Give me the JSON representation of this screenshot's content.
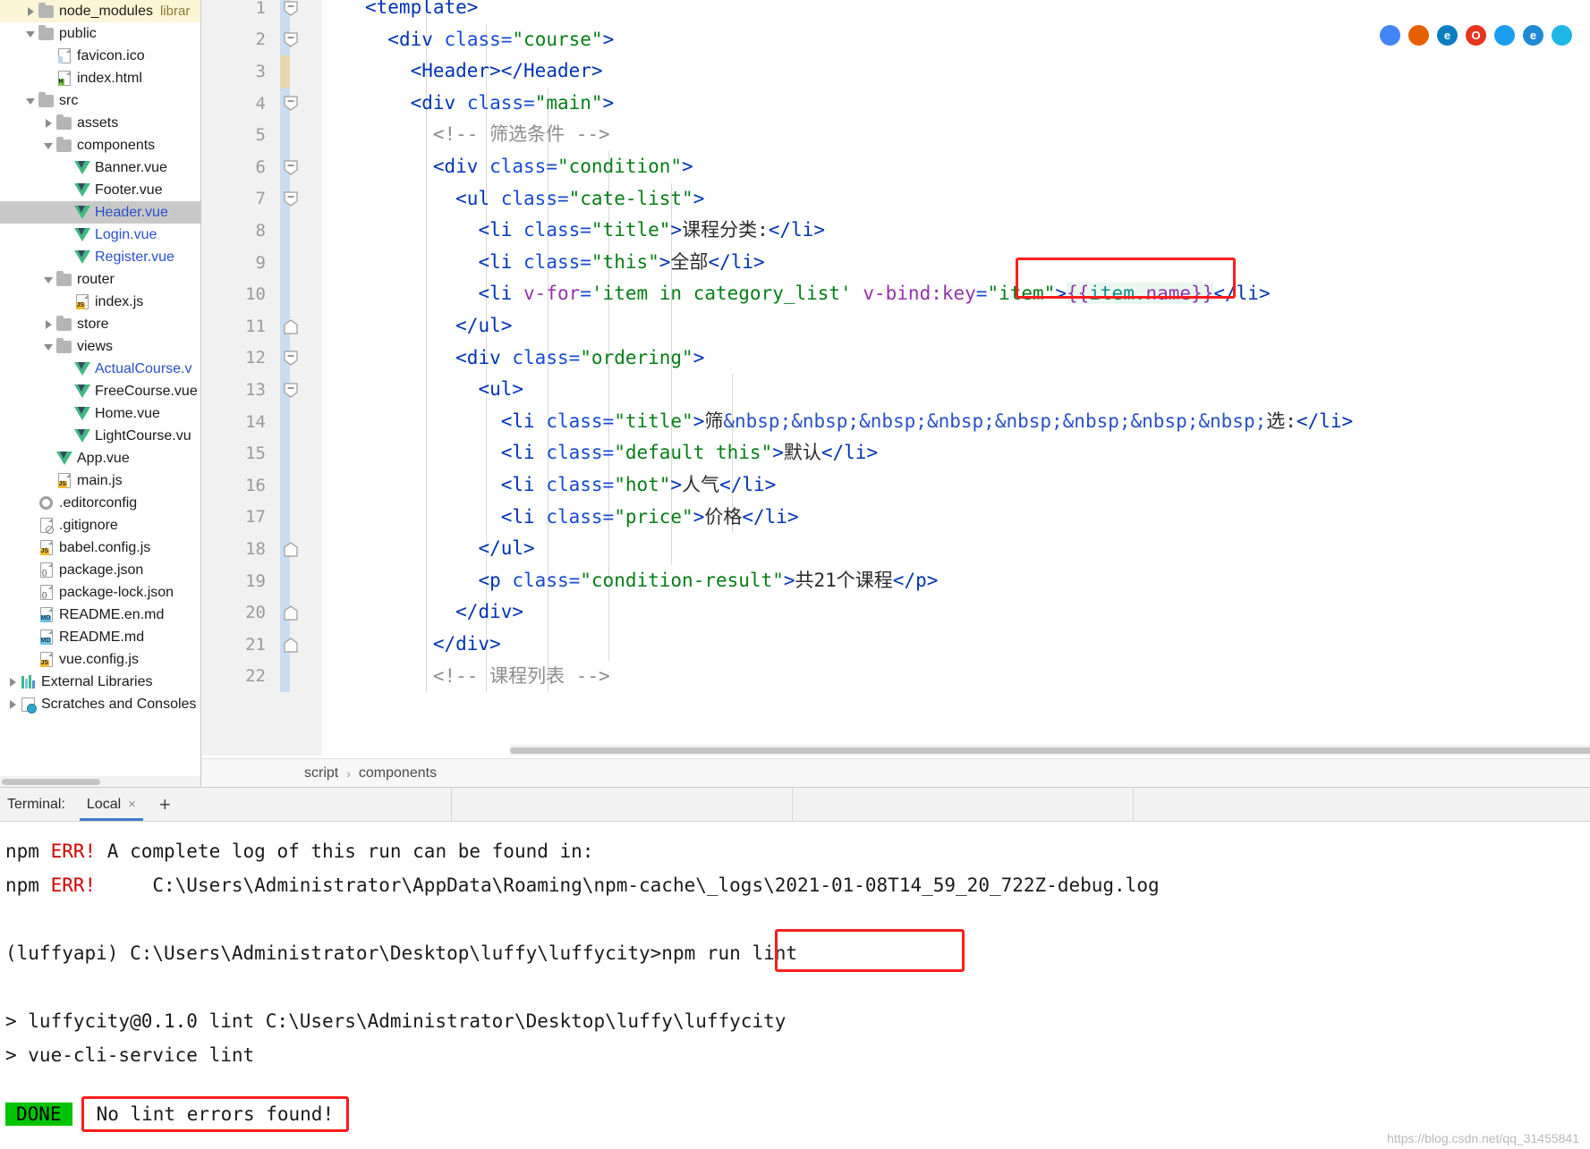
{
  "project_tree": [
    {
      "indent": 1,
      "arrow": "right",
      "icon": "folder-icon",
      "label": "node_modules",
      "tag": "librar",
      "color": "dark",
      "state": "highlight"
    },
    {
      "indent": 1,
      "arrow": "down",
      "icon": "folder-icon",
      "label": "public",
      "color": "dark"
    },
    {
      "indent": 2,
      "arrow": "none",
      "icon": "image-file-icon",
      "label": "favicon.ico",
      "color": "dark"
    },
    {
      "indent": 2,
      "arrow": "none",
      "icon": "html-file-icon",
      "label": "index.html",
      "color": "dark"
    },
    {
      "indent": 1,
      "arrow": "down",
      "icon": "folder-icon",
      "label": "src",
      "color": "dark"
    },
    {
      "indent": 2,
      "arrow": "right",
      "icon": "folder-icon",
      "label": "assets",
      "color": "dark"
    },
    {
      "indent": 2,
      "arrow": "down",
      "icon": "folder-icon",
      "label": "components",
      "color": "dark"
    },
    {
      "indent": 3,
      "arrow": "none",
      "icon": "vue-file-icon",
      "label": "Banner.vue",
      "color": "dark"
    },
    {
      "indent": 3,
      "arrow": "none",
      "icon": "vue-file-icon",
      "label": "Footer.vue",
      "color": "dark"
    },
    {
      "indent": 3,
      "arrow": "none",
      "icon": "vue-file-icon",
      "label": "Header.vue",
      "color": "blue",
      "state": "selected"
    },
    {
      "indent": 3,
      "arrow": "none",
      "icon": "vue-file-icon",
      "label": "Login.vue",
      "color": "blue"
    },
    {
      "indent": 3,
      "arrow": "none",
      "icon": "vue-file-icon",
      "label": "Register.vue",
      "color": "blue"
    },
    {
      "indent": 2,
      "arrow": "down",
      "icon": "folder-icon",
      "label": "router",
      "color": "dark"
    },
    {
      "indent": 3,
      "arrow": "none",
      "icon": "js-file-icon",
      "label": "index.js",
      "color": "dark"
    },
    {
      "indent": 2,
      "arrow": "right",
      "icon": "folder-icon",
      "label": "store",
      "color": "dark"
    },
    {
      "indent": 2,
      "arrow": "down",
      "icon": "folder-icon",
      "label": "views",
      "color": "dark"
    },
    {
      "indent": 3,
      "arrow": "none",
      "icon": "vue-file-icon",
      "label": "ActualCourse.v",
      "color": "blue"
    },
    {
      "indent": 3,
      "arrow": "none",
      "icon": "vue-file-icon",
      "label": "FreeCourse.vue",
      "color": "dark"
    },
    {
      "indent": 3,
      "arrow": "none",
      "icon": "vue-file-icon",
      "label": "Home.vue",
      "color": "dark"
    },
    {
      "indent": 3,
      "arrow": "none",
      "icon": "vue-file-icon",
      "label": "LightCourse.vu",
      "color": "dark"
    },
    {
      "indent": 2,
      "arrow": "none",
      "icon": "vue-file-icon",
      "label": "App.vue",
      "color": "dark"
    },
    {
      "indent": 2,
      "arrow": "none",
      "icon": "js-file-icon",
      "label": "main.js",
      "color": "dark"
    },
    {
      "indent": 1,
      "arrow": "none",
      "icon": "gear-icon",
      "label": ".editorconfig",
      "color": "dark"
    },
    {
      "indent": 1,
      "arrow": "none",
      "icon": "gitignore-icon",
      "label": ".gitignore",
      "color": "dark"
    },
    {
      "indent": 1,
      "arrow": "none",
      "icon": "js-file-icon",
      "label": "babel.config.js",
      "color": "dark"
    },
    {
      "indent": 1,
      "arrow": "none",
      "icon": "json-file-icon",
      "label": "package.json",
      "color": "dark"
    },
    {
      "indent": 1,
      "arrow": "none",
      "icon": "json-file-icon",
      "label": "package-lock.json",
      "color": "dark"
    },
    {
      "indent": 1,
      "arrow": "none",
      "icon": "md-file-icon",
      "label": "README.en.md",
      "color": "dark"
    },
    {
      "indent": 1,
      "arrow": "none",
      "icon": "md-file-icon",
      "label": "README.md",
      "color": "dark"
    },
    {
      "indent": 1,
      "arrow": "none",
      "icon": "js-file-icon",
      "label": "vue.config.js",
      "color": "dark"
    },
    {
      "indent": 0,
      "arrow": "right",
      "icon": "external-libraries-icon",
      "label": "External Libraries",
      "color": "dark"
    },
    {
      "indent": 0,
      "arrow": "right",
      "icon": "scratches-icon",
      "label": "Scratches and Consoles",
      "color": "dark"
    }
  ],
  "editor": {
    "line_numbers": [
      "1",
      "2",
      "3",
      "4",
      "5",
      "6",
      "7",
      "8",
      "9",
      "10",
      "11",
      "12",
      "13",
      "14",
      "15",
      "16",
      "17",
      "18",
      "19",
      "20",
      "21",
      "22"
    ],
    "code_lines": [
      "<template>",
      "  <div class=\"course\">",
      "    <Header></Header>",
      "    <div class=\"main\">",
      "      <!-- 筛选条件 -->",
      "      <div class=\"condition\">",
      "        <ul class=\"cate-list\">",
      "          <li class=\"title\">课程分类:</li>",
      "          <li class=\"this\">全部</li>",
      "          <li v-for='item in category_list' v-bind:key=\"item\">{{item.name}}</li>",
      "        </ul>",
      "        <div class=\"ordering\">",
      "          <ul>",
      "            <li class=\"title\">筛&nbsp;&nbsp;&nbsp;&nbsp;&nbsp;&nbsp;&nbsp;&nbsp;选:</li>",
      "            <li class=\"default this\">默认</li>",
      "            <li class=\"hot\">人气</li>",
      "            <li class=\"price\">价格</li>",
      "          </ul>",
      "          <p class=\"condition-result\">共21个课程</p>",
      "        </div>",
      "      </div>",
      "      <!-- 课程列表 -->"
    ],
    "highlight_box_label": "v-bind:key=\"item\"",
    "breadcrumb": [
      "script",
      "components"
    ],
    "breadcrumb_separator": "›"
  },
  "browser_icons": [
    {
      "name": "chrome-icon",
      "glyph": "",
      "color": "#4285f4"
    },
    {
      "name": "firefox-icon",
      "glyph": "",
      "color": "#e66000"
    },
    {
      "name": "edge-legacy-icon",
      "glyph": "e",
      "color": "#0b7dc0"
    },
    {
      "name": "opera-icon",
      "glyph": "O",
      "color": "#e8341c"
    },
    {
      "name": "safari-icon",
      "glyph": "",
      "color": "#1b9df0"
    },
    {
      "name": "ie-icon",
      "glyph": "e",
      "color": "#1e8ad6"
    },
    {
      "name": "edge-icon",
      "glyph": "",
      "color": "#1fb6e6"
    }
  ],
  "terminal": {
    "label": "Terminal:",
    "tab_name": "Local",
    "tab_close_glyph": "×",
    "add_tab_glyph": "+",
    "lines": [
      {
        "prefix": "npm ",
        "err": "ERR!",
        "rest": " A complete log of this run can be found in:"
      },
      {
        "prefix": "npm ",
        "err": "ERR!",
        "rest": "     C:\\Users\\Administrator\\AppData\\Roaming\\npm-cache\\_logs\\2021-01-08T14_59_20_722Z-debug.log"
      },
      {
        "plain": ""
      },
      {
        "plain": "(luffyapi) C:\\Users\\Administrator\\Desktop\\luffy\\luffycity>npm run lint"
      },
      {
        "plain": ""
      },
      {
        "plain": "> luffycity@0.1.0 lint C:\\Users\\Administrator\\Desktop\\luffy\\luffycity"
      },
      {
        "plain": "> vue-cli-service lint"
      },
      {
        "plain": ""
      }
    ],
    "prompt_command": "npm run lint",
    "done_badge": "DONE",
    "result_message": "No lint errors found!"
  },
  "watermark": "https://blog.csdn.net/qq_31455841"
}
